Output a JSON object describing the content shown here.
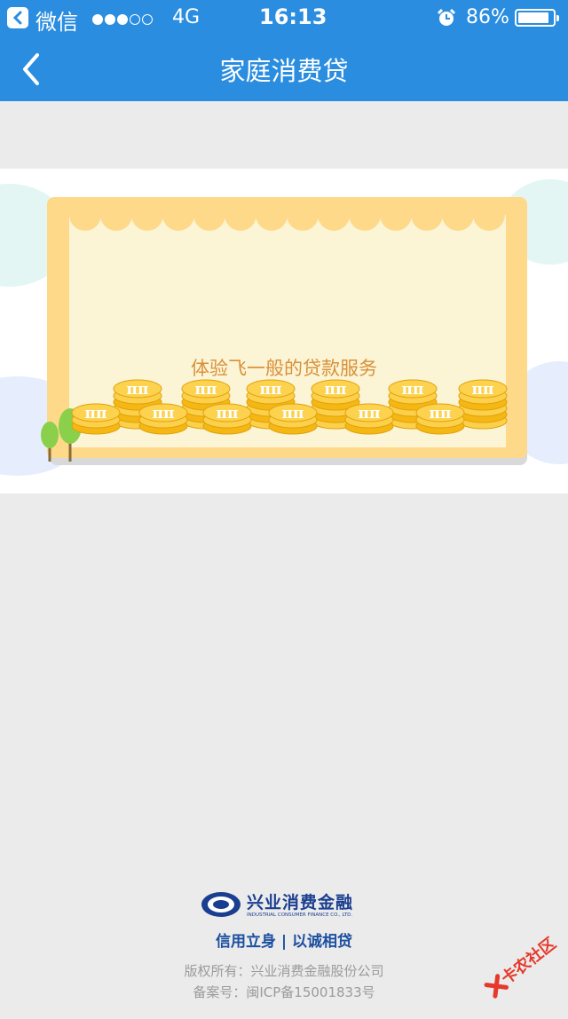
{
  "status_bar": {
    "back_app_label": "微信",
    "network": "4G",
    "time": "16:13",
    "battery_percent": "86%",
    "battery_level": 0.86,
    "signal_strength": 3,
    "signal_max": 5
  },
  "nav": {
    "title": "家庭消费贷",
    "back_icon": "chevron-left-icon"
  },
  "banner": {
    "slogan": "体验飞一般的贷款服务",
    "coin_symbol": "π"
  },
  "footer": {
    "logo_cn": "兴业消费金融",
    "logo_en": "INDUSTRIAL CONSUMER FINANCE CO., LTD.",
    "motto": "信用立身 | 以诚相贷",
    "copyright": "版权所有：兴业消费金融股份公司",
    "icp": "备案号：闽ICP备15001833号"
  },
  "watermark": {
    "text": "卡农社区"
  },
  "colors": {
    "nav_bg": "#2a8de0",
    "page_bg": "#ebebeb",
    "frame": "#ffd98a",
    "coin": "#f9c21a",
    "slogan": "#d9903a",
    "brand_blue": "#1b3f8f",
    "watermark_red": "#e53a2b"
  }
}
